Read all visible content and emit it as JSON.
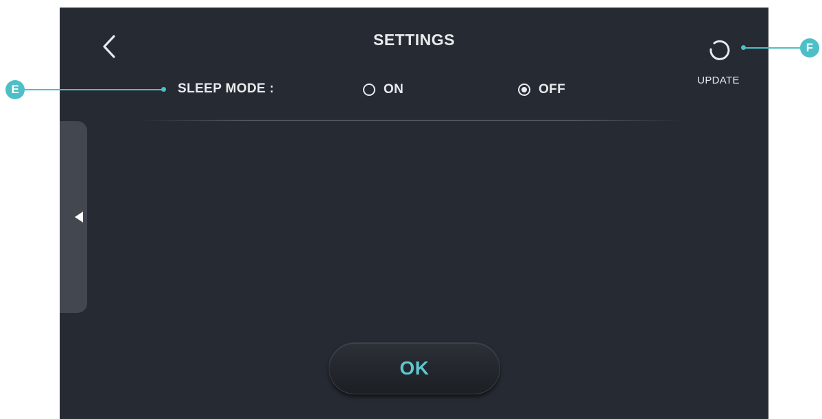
{
  "header": {
    "title": "SETTINGS",
    "back_icon": "chevron-left-icon",
    "update": {
      "icon": "refresh-icon",
      "label": "UPDATE"
    }
  },
  "sleep_mode": {
    "label": "SLEEP MODE :",
    "options": [
      {
        "label": "ON",
        "selected": false
      },
      {
        "label": "OFF",
        "selected": true
      }
    ]
  },
  "side_panel": {
    "icon": "triangle-left-icon"
  },
  "footer": {
    "ok_label": "OK"
  },
  "callouts": {
    "e": "E",
    "f": "F"
  },
  "colors": {
    "screen_bg": "#262b33",
    "text": "#e8eaed",
    "accent": "#4dbfc7",
    "ok_text": "#5ec6cf",
    "side_tab": "#424750"
  }
}
